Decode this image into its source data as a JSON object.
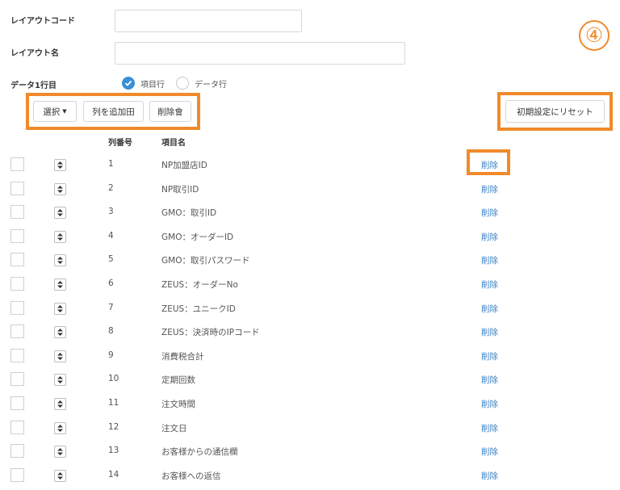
{
  "form": {
    "layout_code_label": "レイアウトコード",
    "layout_code_value": "",
    "layout_name_label": "レイアウト名",
    "layout_name_value": "",
    "first_row_label": "データ1行目",
    "radio_options": [
      {
        "label": "項目行",
        "checked": true
      },
      {
        "label": "データ行",
        "checked": false
      }
    ]
  },
  "toolbar": {
    "select_label": "選択",
    "add_column_label": "列を追加田",
    "delete_label": "削除會",
    "reset_label": "初期設定にリセット"
  },
  "annotation": {
    "step_number": "④",
    "highlight_color": "#f08a2a"
  },
  "table": {
    "headers": {
      "number": "列番号",
      "name": "項目名"
    },
    "delete_label": "削除",
    "rows": [
      {
        "num": "1",
        "name": "NP加盟店ID"
      },
      {
        "num": "2",
        "name": "NP取引ID"
      },
      {
        "num": "3",
        "name": "GMO：取引ID"
      },
      {
        "num": "4",
        "name": "GMO：オーダーID"
      },
      {
        "num": "5",
        "name": "GMO：取引パスワード"
      },
      {
        "num": "6",
        "name": "ZEUS：オーダーNo"
      },
      {
        "num": "7",
        "name": "ZEUS：ユニークID"
      },
      {
        "num": "8",
        "name": "ZEUS：決済時のIPコード"
      },
      {
        "num": "9",
        "name": "消費税合計"
      },
      {
        "num": "10",
        "name": "定期回数"
      },
      {
        "num": "11",
        "name": "注文時間"
      },
      {
        "num": "12",
        "name": "注文日"
      },
      {
        "num": "13",
        "name": "お客様からの通信欄"
      },
      {
        "num": "14",
        "name": "お客様への返信"
      }
    ]
  },
  "colors": {
    "accent": "#3a8fd6",
    "link": "#3a82c4",
    "highlight": "#f08a2a"
  }
}
